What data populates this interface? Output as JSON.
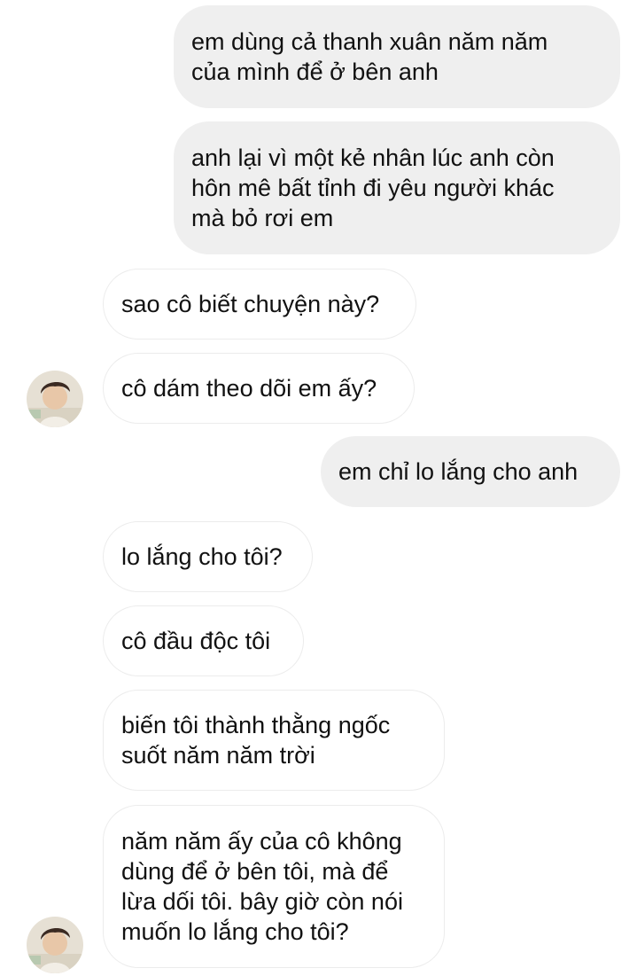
{
  "conversation": {
    "messages": [
      {
        "sender": "me",
        "lines": [
          "em dùng cả thanh xuân năm năm",
          "của mình để ở bên anh"
        ]
      },
      {
        "sender": "me",
        "lines": [
          "anh lại vì một kẻ nhân lúc anh còn",
          "hôn mê bất tỉnh đi yêu người khác",
          "mà bỏ rơi em"
        ]
      },
      {
        "sender": "them",
        "lines": [
          "sao cô biết chuyện này?"
        ]
      },
      {
        "sender": "them",
        "lines": [
          "cô dám theo dõi em ấy?"
        ]
      },
      {
        "sender": "me",
        "lines": [
          "em chỉ lo lắng cho anh"
        ]
      },
      {
        "sender": "them",
        "lines": [
          "lo lắng cho tôi?"
        ]
      },
      {
        "sender": "them",
        "lines": [
          "cô đầu độc tôi"
        ]
      },
      {
        "sender": "them",
        "lines": [
          "biến tôi thành thằng ngốc",
          "suốt năm năm trời"
        ]
      },
      {
        "sender": "them",
        "lines": [
          "năm năm ấy của cô không",
          "dùng để ở bên tôi, mà để",
          "lừa dối tôi. bây giờ còn nói",
          "muốn lo lắng cho tôi?"
        ]
      }
    ]
  },
  "colors": {
    "outgoing_bubble": "#efefef",
    "incoming_bubble": "#ffffff",
    "incoming_border": "#ececec",
    "text": "#111111"
  },
  "icons": {
    "avatar": "contact-avatar-photo"
  }
}
